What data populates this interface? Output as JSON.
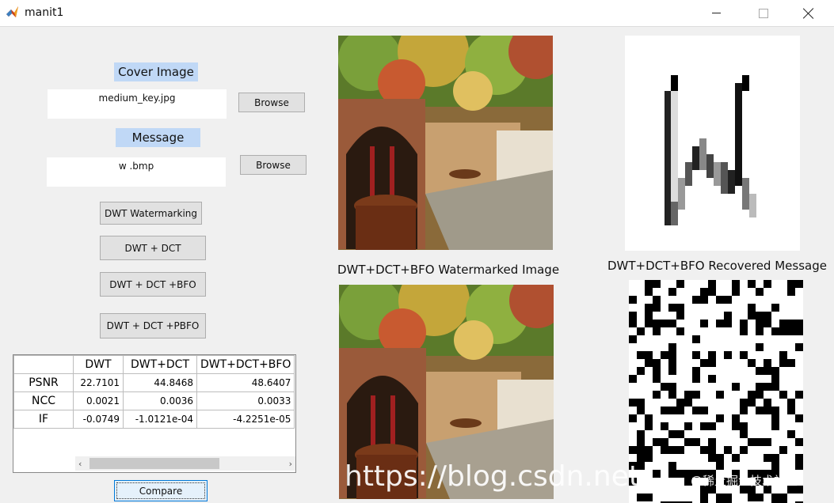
{
  "window": {
    "title": "manit1"
  },
  "cover": {
    "label": "Cover Image",
    "file": "medium_key.jpg",
    "browse": "Browse"
  },
  "message": {
    "label": "Message",
    "file": "w .bmp",
    "browse": "Browse"
  },
  "buttons": {
    "dwt": "DWT Watermarking",
    "dwt_dct": "DWT + DCT",
    "dwt_dct_bfo": "DWT + DCT +BFO",
    "dwt_dct_pbfo": "DWT + DCT +PBFO",
    "compare": "Compare"
  },
  "table": {
    "columns": [
      "DWT",
      "DWT+DCT",
      "DWT+DCT+BFO"
    ],
    "rows": [
      {
        "name": "PSNR",
        "values": [
          "22.7101",
          "44.8468",
          "48.6407"
        ]
      },
      {
        "name": "NCC",
        "values": [
          "0.0021",
          "0.0036",
          "0.0033"
        ]
      },
      {
        "name": "IF",
        "values": [
          "-0.0749",
          "-1.0121e-04",
          "-4.2251e-05"
        ]
      }
    ]
  },
  "captions": {
    "watermarked": "DWT+DCT+BFO Watermarked Image",
    "recovered": "DWT+DCT+BFO Recovered Message"
  },
  "overlay": {
    "url": "https://blog.csdn.net/",
    "site": "@稀土掘金技术社区"
  },
  "icons": {
    "app": "matlab-icon",
    "scroll_left": "‹",
    "scroll_right": "›"
  }
}
